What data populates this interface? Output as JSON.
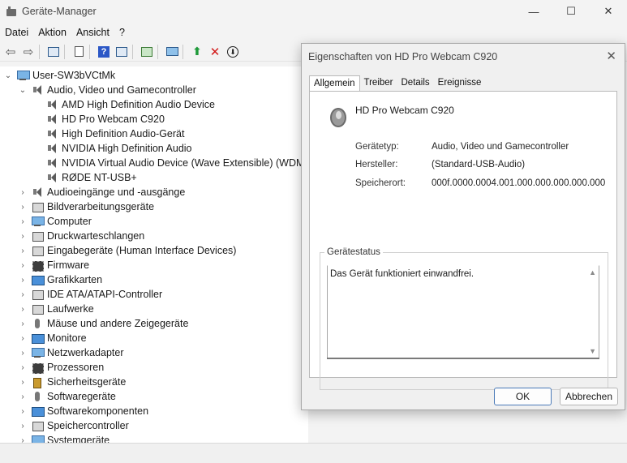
{
  "window": {
    "title": "Geräte-Manager",
    "minimize": "—",
    "maximize": "☐",
    "close": "✕"
  },
  "menu": [
    "Datei",
    "Aktion",
    "Ansicht",
    "?"
  ],
  "tree": {
    "root": "User-SW3bVCtMk",
    "expanded_category": "Audio, Video und Gamecontroller",
    "children": [
      "AMD High Definition Audio Device",
      "HD Pro Webcam C920",
      "High Definition Audio-Gerät",
      "NVIDIA High Definition Audio",
      "NVIDIA Virtual Audio Device (Wave Extensible) (WDM)",
      "RØDE NT-USB+"
    ],
    "categories": [
      {
        "label": "Audioeingänge und -ausgänge",
        "icon": "speaker-icon"
      },
      {
        "label": "Bildverarbeitungsgeräte",
        "icon": "camera-icon"
      },
      {
        "label": "Computer",
        "icon": "computer-icon"
      },
      {
        "label": "Druckwarteschlangen",
        "icon": "printer-icon"
      },
      {
        "label": "Eingabegeräte (Human Interface Devices)",
        "icon": "hid-icon"
      },
      {
        "label": "Firmware",
        "icon": "firmware-icon"
      },
      {
        "label": "Grafikkarten",
        "icon": "display-adapter-icon"
      },
      {
        "label": "IDE ATA/ATAPI-Controller",
        "icon": "ide-controller-icon"
      },
      {
        "label": "Laufwerke",
        "icon": "drive-icon"
      },
      {
        "label": "Mäuse und andere Zeigegeräte",
        "icon": "mouse-icon"
      },
      {
        "label": "Monitore",
        "icon": "monitor-icon"
      },
      {
        "label": "Netzwerkadapter",
        "icon": "network-adapter-icon"
      },
      {
        "label": "Prozessoren",
        "icon": "processor-icon"
      },
      {
        "label": "Sicherheitsgeräte",
        "icon": "security-device-icon"
      },
      {
        "label": "Softwaregeräte",
        "icon": "software-device-icon"
      },
      {
        "label": "Softwarekomponenten",
        "icon": "software-component-icon"
      },
      {
        "label": "Speichercontroller",
        "icon": "storage-controller-icon"
      },
      {
        "label": "Systemgeräte",
        "icon": "system-device-icon"
      }
    ]
  },
  "dialog": {
    "title": "Eigenschaften von HD Pro Webcam C920",
    "tabs": [
      "Allgemein",
      "Treiber",
      "Details",
      "Ereignisse"
    ],
    "device_name": "HD Pro Webcam C920",
    "props": [
      {
        "label": "Gerätetyp:",
        "value": "Audio, Video und Gamecontroller"
      },
      {
        "label": "Hersteller:",
        "value": "(Standard-USB-Audio)"
      },
      {
        "label": "Speicherort:",
        "value": "000f.0000.0004.001.000.000.000.000.000"
      }
    ],
    "status_group": "Gerätestatus",
    "status_text": "Das Gerät funktioniert einwandfrei.",
    "ok": "OK",
    "cancel": "Abbrechen"
  }
}
